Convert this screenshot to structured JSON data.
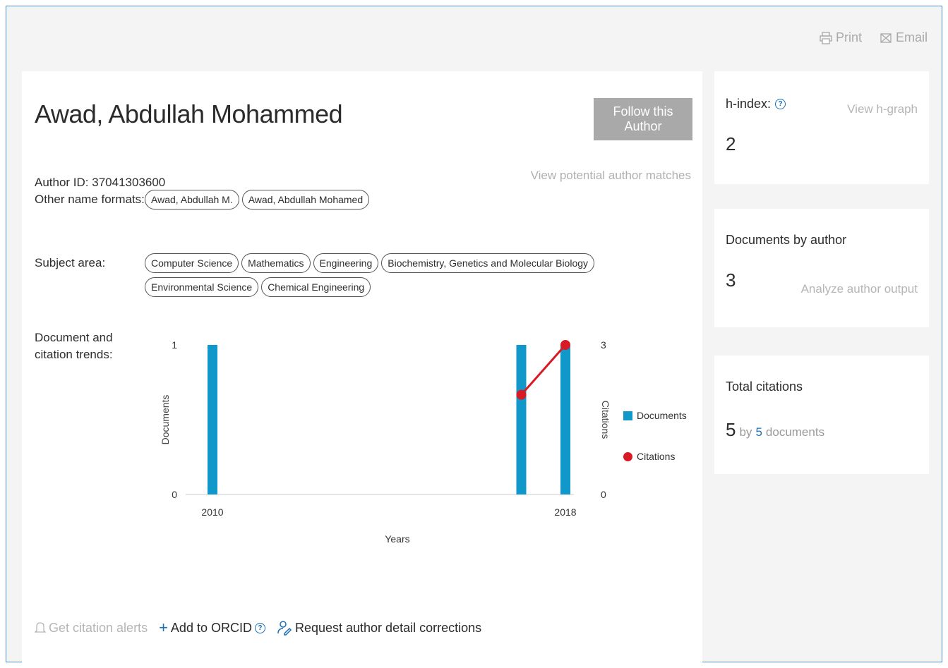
{
  "topbar": {
    "print_label": "Print",
    "email_label": "Email"
  },
  "author": {
    "name": "Awad, Abdullah Mohammed",
    "follow_label": "Follow this Author",
    "author_id": "Author ID: 37041303600",
    "potential_matches_label": "View potential author matches",
    "other_names_label": "Other name formats:",
    "other_names": [
      "Awad, Abdullah M.",
      "Awad, Abdullah Mohamed"
    ],
    "subject_area_label": "Subject area:",
    "subject_areas": [
      "Computer Science",
      "Mathematics",
      "Engineering",
      "Biochemistry, Genetics and Molecular Biology",
      "Environmental Science",
      "Chemical Engineering"
    ],
    "trends_label_line1": "Document and",
    "trends_label_line2": "citation trends:"
  },
  "chart_data": {
    "type": "bar",
    "x": [
      2010,
      2017,
      2018
    ],
    "xlim": [
      2010,
      2018
    ],
    "xticks": [
      "2010",
      "2018"
    ],
    "xlabel": "Years",
    "ylabel_left": "Documents",
    "ylabel_right": "Citations",
    "ylim_left": [
      0,
      1
    ],
    "ylim_right": [
      0,
      3
    ],
    "yticks_left": [
      "0",
      "1"
    ],
    "yticks_right": [
      "0",
      "3"
    ],
    "series": [
      {
        "name": "Documents",
        "kind": "bar",
        "axis": "left",
        "color": "#0f98c9",
        "values": [
          1,
          1,
          1
        ]
      },
      {
        "name": "Citations",
        "kind": "line",
        "axis": "right",
        "color": "#d71a24",
        "values": [
          null,
          2,
          3
        ]
      }
    ],
    "legend": "right"
  },
  "actions": {
    "citation_alerts_label": "Get citation alerts",
    "orcid_label": "Add to ORCID",
    "corrections_label": "Request author detail corrections"
  },
  "metrics": {
    "h_index_label": "h-index:",
    "h_graph_label": "View h-graph",
    "h_index_value": "2",
    "documents_label": "Documents by author",
    "documents_value": "3",
    "analyze_label": "Analyze author output",
    "citations_label": "Total citations",
    "citations_value": "5",
    "citations_by": "by",
    "citations_docs_count": "5",
    "citations_docs_word": "documents"
  },
  "colors": {
    "accent": "#1a6fb5",
    "documents_bar": "#0f98c9",
    "citations_line": "#d71a24",
    "follow_button": "#a9a9a9"
  }
}
